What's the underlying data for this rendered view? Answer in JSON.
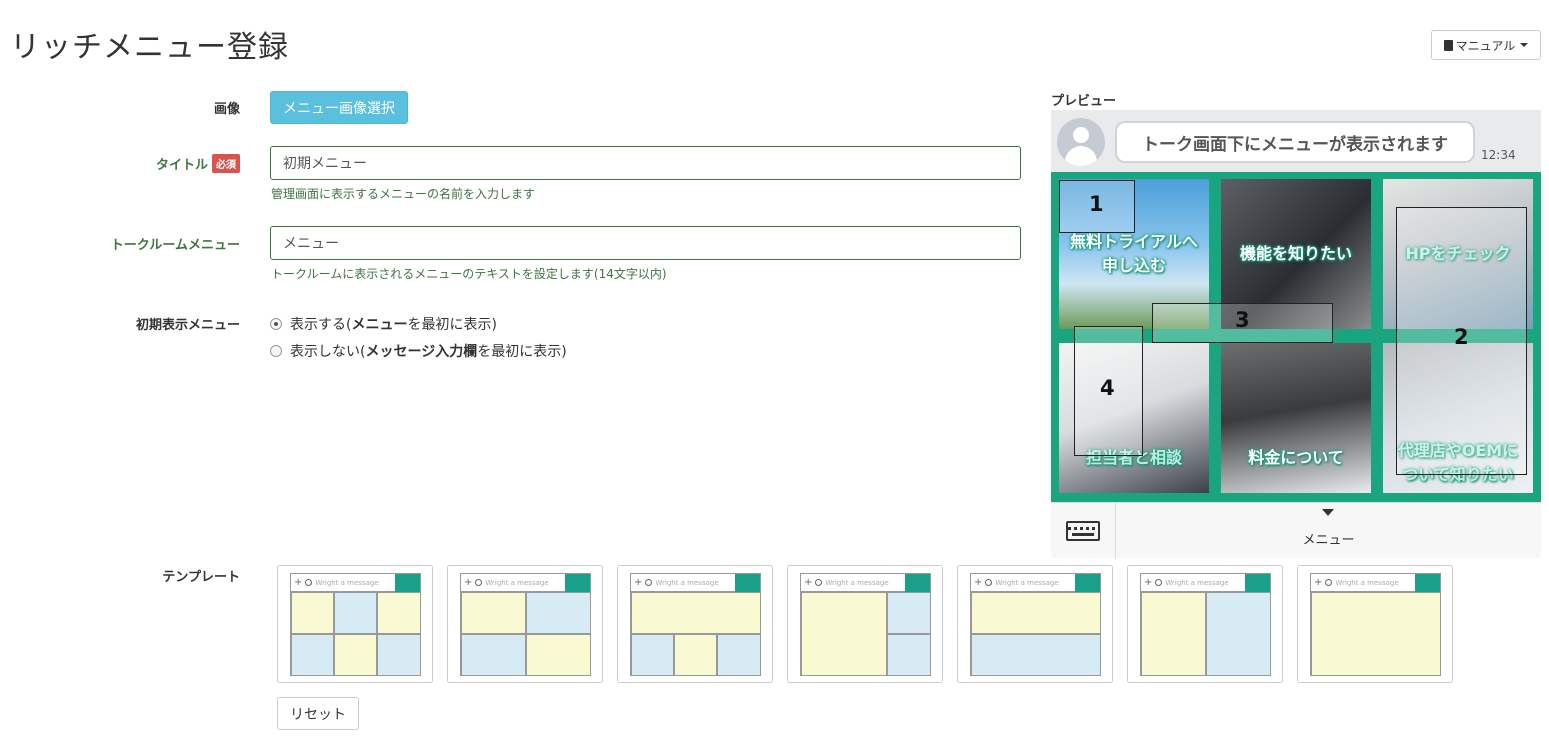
{
  "page": {
    "title": "リッチメニュー登録",
    "manual_label": "マニュアル"
  },
  "form": {
    "image": {
      "label": "画像",
      "button_label": "メニュー画像選択"
    },
    "title_field": {
      "label": "タイトル",
      "required_badge": "必須",
      "value": "初期メニュー",
      "help": "管理画面に表示するメニューの名前を入力します"
    },
    "talkroom_menu": {
      "label": "トークルームメニュー",
      "value": "メニュー",
      "help": "トークルームに表示されるメニューのテキストを設定します(14文字以内)"
    },
    "initial_display": {
      "label": "初期表示メニュー",
      "options": [
        {
          "prefix": "表示する(",
          "bold": "メニュー",
          "suffix": "を最初に表示)",
          "checked": true
        },
        {
          "prefix": "表示しない(",
          "bold": "メッセージ入力欄",
          "suffix": "を最初に表示)",
          "checked": false
        }
      ]
    }
  },
  "preview": {
    "label": "プレビュー",
    "chat_message": "トーク画面下にメニューが表示されます",
    "time": "12:34",
    "tiles": [
      {
        "line1": "無料トライアルへ",
        "line2": "申し込む"
      },
      {
        "line1": "機能を知りたい",
        "line2": ""
      },
      {
        "line1": "HPをチェック",
        "line2": ""
      },
      {
        "line1": "担当者と相談",
        "line2": ""
      },
      {
        "line1": "料金について",
        "line2": ""
      },
      {
        "line1": "代理店やOEMに",
        "line2": "ついて知りたい"
      }
    ],
    "areas": [
      "1",
      "2",
      "3",
      "4"
    ],
    "menu_bar_text": "メニュー",
    "accent_color": "#1aa581"
  },
  "templates": {
    "label": "テンプレート",
    "placeholder": "Wright a message",
    "reset_label": "リセット",
    "count": 7
  }
}
